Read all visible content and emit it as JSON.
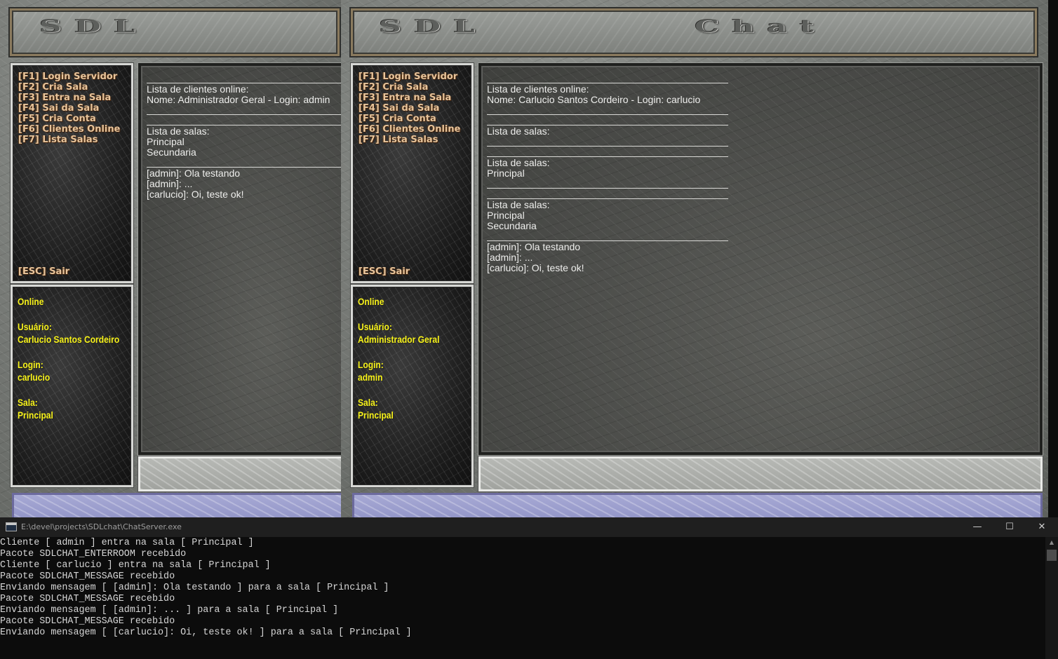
{
  "left_window": {
    "banner_text": "SDL",
    "menu": [
      "[F1] Login Servidor",
      "[F2] Cria Sala",
      "[F3] Entra na Sala",
      "[F4] Sai da Sala",
      "[F5] Cria Conta",
      "[F6] Clientes Online",
      "[F7] Lista Salas"
    ],
    "exit_label": "[ESC] Sair",
    "status": {
      "state": "Online",
      "user_label": "Usuário:",
      "user_value": "Carlucio Santos Cordeiro",
      "login_label": "Login:",
      "login_value": "carlucio",
      "room_label": "Sala:",
      "room_value": "Principal"
    },
    "chat_lines": [
      "Lista de clientes online:",
      "Nome: Administrador Geral - Login: admin",
      "Lista de salas:",
      "Principal",
      "Secundaria",
      "[admin]: Ola testando",
      "[admin]: ...",
      "[carlucio]: Oi, teste ok!"
    ]
  },
  "right_window": {
    "banner_text": "SDL",
    "banner_text_2": "Chat",
    "menu": [
      "[F1] Login Servidor",
      "[F2] Cria Sala",
      "[F3] Entra na Sala",
      "[F4] Sai da Sala",
      "[F5] Cria Conta",
      "[F6] Clientes Online",
      "[F7] Lista Salas"
    ],
    "exit_label": "[ESC] Sair",
    "status": {
      "state": "Online",
      "user_label": "Usuário:",
      "user_value": "Administrador Geral",
      "login_label": "Login:",
      "login_value": "admin",
      "room_label": "Sala:",
      "room_value": "Principal"
    },
    "chat_lines": [
      "Lista de clientes online:",
      "Nome: Carlucio Santos Cordeiro - Login: carlucio",
      "Lista de salas:",
      "Lista de salas:",
      "Principal",
      "Lista de salas:",
      "Principal",
      "Secundaria",
      "[admin]: Ola testando",
      "[admin]: ...",
      "[carlucio]: Oi, teste ok!"
    ]
  },
  "console": {
    "title": "E:\\devel\\projects\\SDLchat\\ChatServer.exe",
    "lines": [
      "Cliente [ admin ] entra na sala [ Principal ]",
      "Pacote SDLCHAT_ENTERROOM recebido",
      "Cliente [ carlucio ] entra na sala [ Principal ]",
      "Pacote SDLCHAT_MESSAGE recebido",
      "Enviando mensagem [ [admin]: Ola testando ] para a sala [ Principal ]",
      "Pacote SDLCHAT_MESSAGE recebido",
      "Enviando mensagem [ [admin]: ... ] para a sala [ Principal ]",
      "Pacote SDLCHAT_MESSAGE recebido",
      "Enviando mensagem [ [carlucio]: Oi, teste ok! ] para a sala [ Principal ]"
    ],
    "minimize_glyph": "—",
    "maximize_glyph": "☐",
    "close_glyph": "✕"
  }
}
